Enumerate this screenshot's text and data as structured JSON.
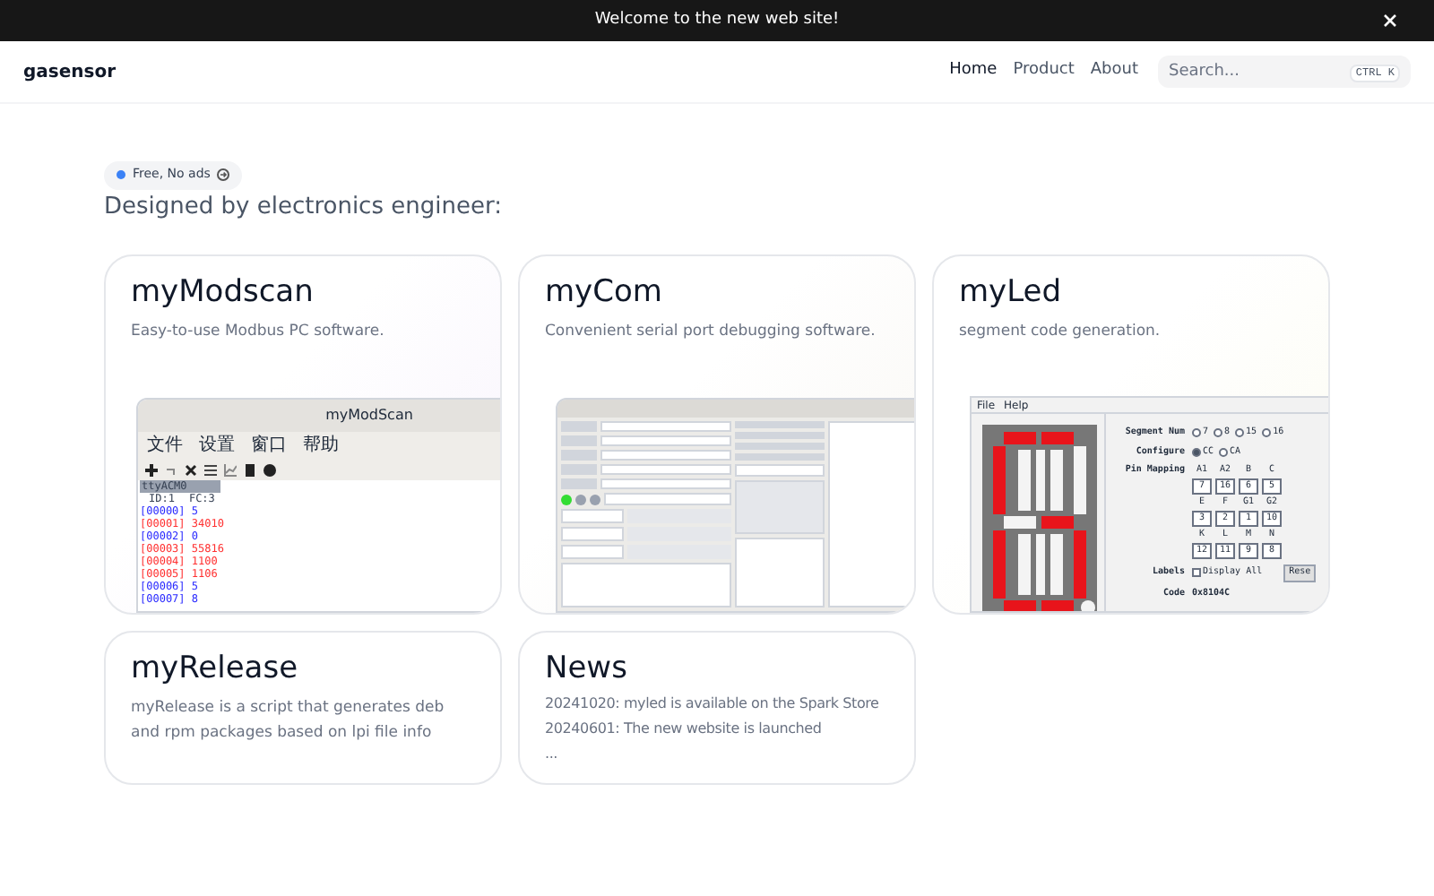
{
  "banner": {
    "text": "Welcome to the new web site!"
  },
  "header": {
    "brand": "gasensor",
    "nav": [
      {
        "label": "Home",
        "selected": true
      },
      {
        "label": "Product",
        "selected": false
      },
      {
        "label": "About",
        "selected": false
      }
    ],
    "search": {
      "placeholder": "Search...",
      "shortcut": "CTRL K"
    }
  },
  "hero": {
    "badge": "Free, No ads",
    "heading": "Designed by electronics engineer:"
  },
  "cards": [
    {
      "kind": "modscan",
      "title": "myModscan",
      "description": "Easy-to-use Modbus PC software.",
      "app": {
        "title": "myModScan",
        "menu": [
          "文件",
          "设置",
          "窗口",
          "帮助"
        ],
        "port": "ttyACM0",
        "id": "ID:1",
        "fc": "FC:3",
        "registers": [
          {
            "address": "[00000]",
            "value": "5",
            "color": "#2a2aff"
          },
          {
            "address": "[00001]",
            "value": "34010",
            "color": "#ff3030"
          },
          {
            "address": "[00002]",
            "value": "0",
            "color": "#2a2aff"
          },
          {
            "address": "[00003]",
            "value": "55816",
            "color": "#ff3030"
          },
          {
            "address": "[00004]",
            "value": "1100",
            "color": "#ff3030"
          },
          {
            "address": "[00005]",
            "value": "1106",
            "color": "#ff3030"
          },
          {
            "address": "[00006]",
            "value": "5",
            "color": "#2a2aff"
          },
          {
            "address": "[00007]",
            "value": "8",
            "color": "#2a2aff"
          }
        ]
      }
    },
    {
      "kind": "com",
      "title": "myCom",
      "description": "Convenient serial port debugging software."
    },
    {
      "kind": "led",
      "title": "myLed",
      "description": "segment code generation.",
      "app": {
        "menu": [
          "File",
          "Help"
        ],
        "segment_label": "Segment Num",
        "segment_options": [
          {
            "label": "7",
            "selected": false
          },
          {
            "label": "8",
            "selected": false
          },
          {
            "label": "15",
            "selected": false
          },
          {
            "label": "16",
            "selected": false
          }
        ],
        "configure_label": "Configure",
        "configure_options": [
          {
            "label": "CC",
            "selected": true
          },
          {
            "label": "CA",
            "selected": false
          }
        ],
        "pin_label": "Pin Mapping",
        "pins": [
          {
            "name": "A1",
            "value": "7"
          },
          {
            "name": "A2",
            "value": "16"
          },
          {
            "name": "B",
            "value": "6"
          },
          {
            "name": "C",
            "value": "5"
          },
          {
            "name": "E",
            "value": "3"
          },
          {
            "name": "F",
            "value": "2"
          },
          {
            "name": "G1",
            "value": "1"
          },
          {
            "name": "G2",
            "value": "10"
          },
          {
            "name": "K",
            "value": "12"
          },
          {
            "name": "L",
            "value": "11"
          },
          {
            "name": "M",
            "value": "9"
          },
          {
            "name": "N",
            "value": "8"
          }
        ],
        "labels_label": "Labels",
        "display_all": {
          "label": "Display All",
          "checked": false
        },
        "reset": "Rese",
        "code_label": "Code",
        "code": "0x8104C"
      }
    },
    {
      "kind": "text",
      "title": "myRelease",
      "description": "myRelease is a script that generates deb and rpm packages based on lpi file info"
    },
    {
      "kind": "news",
      "title": "News",
      "lines": [
        "20241020: myled is available on the Spark Store",
        "20240601: The new website is launched",
        "..."
      ]
    }
  ]
}
